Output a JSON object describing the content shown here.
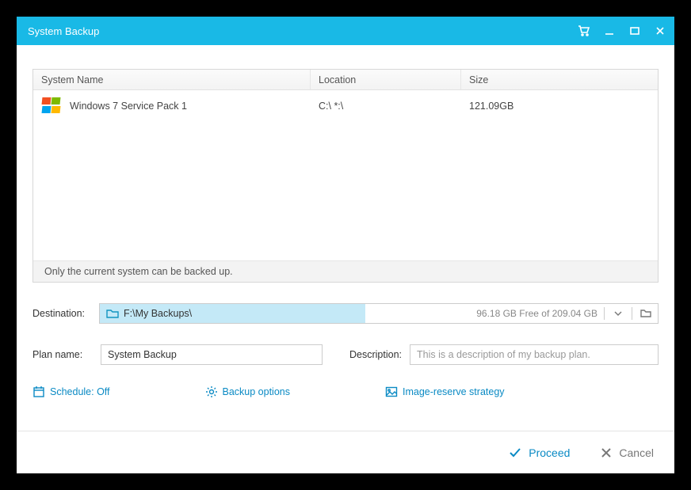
{
  "window": {
    "title": "System Backup"
  },
  "table": {
    "headers": {
      "name": "System Name",
      "location": "Location",
      "size": "Size"
    },
    "rows": [
      {
        "name": "Windows 7 Service Pack 1",
        "location": "C:\\ *:\\",
        "size": "121.09GB"
      }
    ],
    "footer_note": "Only the current system can be backed up."
  },
  "destination": {
    "label": "Destination:",
    "path": "F:\\My Backups\\",
    "freespace": "96.18 GB Free of 209.04 GB"
  },
  "plan": {
    "label": "Plan name:",
    "value": "System Backup"
  },
  "description": {
    "label": "Description:",
    "placeholder": "This is a description of my backup plan."
  },
  "links": {
    "schedule": "Schedule: Off",
    "options": "Backup options",
    "strategy": "Image-reserve strategy"
  },
  "footer": {
    "proceed": "Proceed",
    "cancel": "Cancel"
  }
}
